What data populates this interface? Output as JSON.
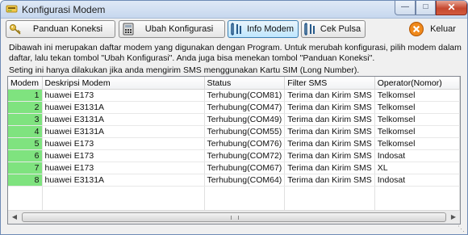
{
  "window": {
    "title": "Konfigurasi Modem"
  },
  "toolbar": {
    "panduan": "Panduan Koneksi",
    "ubah": "Ubah Konfigurasi",
    "info": "Info Modem",
    "cek": "Cek Pulsa",
    "keluar": "Keluar"
  },
  "info": {
    "description": "Dibawah ini merupakan daftar modem yang digunakan dengan Program. Untuk merubah konfigurasi, pilih modem dalam daftar, lalu tekan tombol \"Ubah Konfigurasi\". Anda juga bisa menekan tombol \"Panduan Koneksi\".",
    "note": "Seting ini hanya dilakukan jika anda mengirim SMS menggunakan Kartu SIM (Long Number)."
  },
  "columns": [
    "Modem",
    "Deskripsi Modem",
    "Status",
    "Filter SMS",
    "Operator(Nomor)"
  ],
  "rows": [
    {
      "modem": "1",
      "desc": "huawei E173",
      "status": "Terhubung(COM81)",
      "filter": "Terima dan Kirim SMS",
      "operator": "Telkomsel"
    },
    {
      "modem": "2",
      "desc": "huawei E3131A",
      "status": "Terhubung(COM47)",
      "filter": "Terima dan Kirim SMS",
      "operator": "Telkomsel"
    },
    {
      "modem": "3",
      "desc": "huawei E3131A",
      "status": "Terhubung(COM49)",
      "filter": "Terima dan Kirim SMS",
      "operator": "Telkomsel"
    },
    {
      "modem": "4",
      "desc": "huawei E3131A",
      "status": "Terhubung(COM55)",
      "filter": "Terima dan Kirim SMS",
      "operator": "Telkomsel"
    },
    {
      "modem": "5",
      "desc": "huawei E173",
      "status": "Terhubung(COM76)",
      "filter": "Terima dan Kirim SMS",
      "operator": "Telkomsel"
    },
    {
      "modem": "6",
      "desc": "huawei E173",
      "status": "Terhubung(COM72)",
      "filter": "Terima dan Kirim SMS",
      "operator": "Indosat"
    },
    {
      "modem": "7",
      "desc": "huawei E173",
      "status": "Terhubung(COM67)",
      "filter": "Terima dan Kirim SMS",
      "operator": "XL"
    },
    {
      "modem": "8",
      "desc": "huawei E3131A",
      "status": "Terhubung(COM64)",
      "filter": "Terima dan Kirim SMS",
      "operator": "Indosat"
    }
  ],
  "colors": {
    "modem_cell": "#7fe37f",
    "close_button": "#c5482f",
    "active_tab": "#bee6fd"
  },
  "icons": [
    "modem-icon",
    "key-icon",
    "calculator-icon",
    "info-icon",
    "exit-icon"
  ]
}
